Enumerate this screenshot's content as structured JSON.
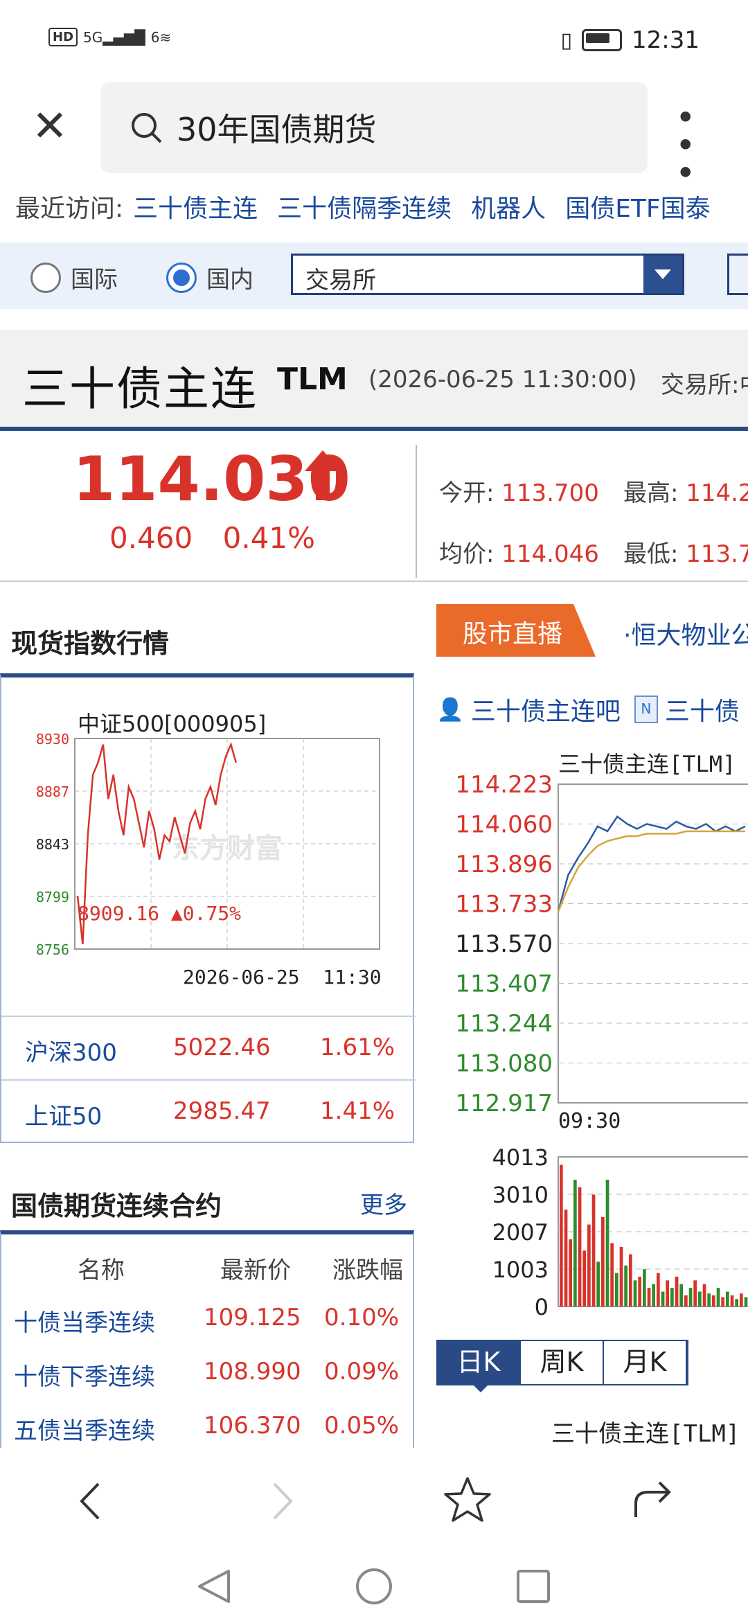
{
  "status_bar": {
    "network": "HD",
    "signal": "5G",
    "wifi": "6",
    "time": "12:31"
  },
  "search": {
    "query": "30年国债期货"
  },
  "recent": {
    "label": "最近访问:",
    "items": [
      "三十债主连",
      "三十债隔季连续",
      "机器人",
      "国债ETF国泰"
    ]
  },
  "filter": {
    "radio_intl": "国际",
    "radio_domestic": "国内",
    "select_value": "交易所"
  },
  "quote": {
    "name": "三十债主连",
    "code": "TLM",
    "time": "(2026-06-25 11:30:00)",
    "exchange": "交易所:中",
    "price": "114.030",
    "change": "0.460",
    "change_pct": "0.41%",
    "open_label": "今开:",
    "open": "113.700",
    "high_label": "最高:",
    "high": "114.2",
    "avg_label": "均价:",
    "avg": "114.046",
    "low_label": "最低:",
    "low": "113.7"
  },
  "spot": {
    "title": "现货指数行情",
    "chart": {
      "title": "中证500[000905]",
      "watermark": "东方财富",
      "last": "8909.16",
      "pct": "▲0.75%",
      "datetime": "2026-06-25  11:30"
    },
    "rows": [
      {
        "name": "沪深300",
        "value": "5022.46",
        "pct": "1.61%"
      },
      {
        "name": "上证50",
        "value": "2985.47",
        "pct": "1.41%"
      }
    ]
  },
  "bonds": {
    "title": "国债期货连续合约",
    "more": "更多",
    "headers": [
      "名称",
      "最新价",
      "涨跌幅"
    ],
    "rows": [
      {
        "name": "十债当季连续",
        "price": "109.125",
        "pct": "0.10%"
      },
      {
        "name": "十债下季连续",
        "price": "108.990",
        "pct": "0.09%"
      },
      {
        "name": "五债当季连续",
        "price": "106.370",
        "pct": "0.05%"
      }
    ]
  },
  "live": {
    "tab": "股市直播",
    "news": "·恒大物业公",
    "link1": "三十债主连吧",
    "link2": "三十债"
  },
  "ktabs": [
    "日K",
    "周K",
    "月K"
  ],
  "bottom_chart_title": "三十债主连[TLM]",
  "chart_data": [
    {
      "type": "line",
      "title": "中证500[000905]",
      "yticks": [
        "8930",
        "8887",
        "8843",
        "8799",
        "8756"
      ],
      "ylim": [
        8756,
        8930
      ],
      "series": [
        {
          "values": [
            8800,
            8760,
            8850,
            8900,
            8910,
            8925,
            8880,
            8900,
            8870,
            8850,
            8890,
            8880,
            8860,
            8840,
            8870,
            8855,
            8830,
            8850,
            8845,
            8865,
            8850,
            8835,
            8860,
            8870,
            8855,
            8880,
            8890,
            8875,
            8900,
            8915,
            8925,
            8910
          ]
        }
      ]
    },
    {
      "type": "line",
      "title": "三十债主连[TLM]",
      "x_start_label": "09:30",
      "yticks": [
        "114.223",
        "114.060",
        "113.896",
        "113.733",
        "113.570",
        "113.407",
        "113.244",
        "113.080",
        "112.917"
      ],
      "ylim": [
        112.917,
        114.223
      ],
      "series": [
        {
          "values": [
            113.7,
            113.85,
            113.92,
            113.98,
            114.05,
            114.03,
            114.09,
            114.06,
            114.04,
            114.06,
            114.05,
            114.04,
            114.07,
            114.05,
            114.04,
            114.06,
            114.03,
            114.05,
            114.03,
            114.05
          ]
        },
        {
          "values": [
            113.7,
            113.8,
            113.88,
            113.93,
            113.97,
            113.99,
            114.0,
            114.01,
            114.01,
            114.02,
            114.02,
            114.02,
            114.02,
            114.03,
            114.03,
            114.03,
            114.03,
            114.03,
            114.03,
            114.03
          ]
        }
      ]
    },
    {
      "type": "bar",
      "title": "",
      "yticks": [
        "4013",
        "3010",
        "2007",
        "1003",
        "0"
      ],
      "ylim": [
        0,
        4013
      ],
      "values": [
        3800,
        2600,
        1800,
        3400,
        3200,
        1500,
        2200,
        3000,
        1200,
        2400,
        3400,
        1700,
        900,
        1600,
        1100,
        1400,
        700,
        800,
        1000,
        500,
        600,
        900,
        400,
        700,
        500,
        800,
        600,
        300,
        500,
        700,
        400,
        600,
        350,
        300,
        500,
        250,
        400,
        300,
        200,
        350,
        250,
        200
      ],
      "colors": [
        "#d8332a",
        "#2e8b2e"
      ]
    }
  ]
}
